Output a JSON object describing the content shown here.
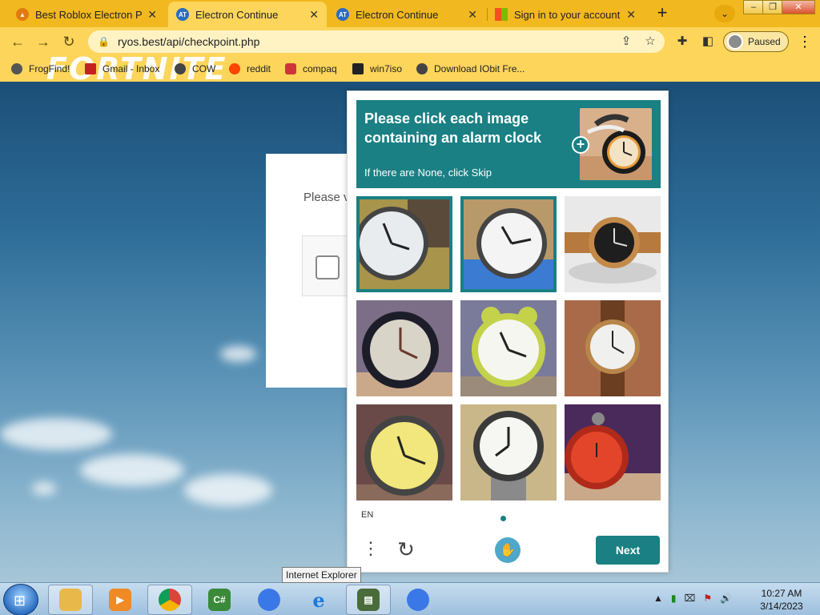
{
  "browser": {
    "tabs": [
      {
        "title": "Best Roblox Electron Prot",
        "active": false
      },
      {
        "title": "Electron Continue",
        "active": true
      },
      {
        "title": "Electron Continue",
        "active": false
      },
      {
        "title": "Sign in to your account",
        "active": false
      }
    ],
    "new_tab": "+",
    "tab_search": "⌄",
    "window": {
      "min": "–",
      "max": "❐",
      "close": "✕"
    },
    "nav": {
      "back": "←",
      "forward": "→",
      "reload": "↻"
    },
    "url": "ryos.best/api/checkpoint.php",
    "profile_status": "Paused",
    "menu": "⋮",
    "bookmarks": [
      {
        "label": "FrogFind!",
        "color": "#555555"
      },
      {
        "label": "Gmail - Inbox",
        "color": "#c5221f"
      },
      {
        "label": "COW",
        "color": "#444444"
      },
      {
        "label": "reddit",
        "color": "#ff4500"
      },
      {
        "label": "compaq",
        "color": "#d13438"
      },
      {
        "label": "win7iso",
        "color": "#222222"
      },
      {
        "label": "Download IObit Fre...",
        "color": "#444444"
      }
    ],
    "logo_text": "FORTNITE"
  },
  "page": {
    "checkbox_prompt": "Please v"
  },
  "captcha": {
    "prompt_title": "Please click each image containing an alarm clock",
    "prompt_sub": "If there are None, click Skip",
    "expand": "+",
    "language": "EN",
    "next_label": "Next",
    "grid": [
      {
        "kind": "wristwatch",
        "selected": true
      },
      {
        "kind": "wristwatch",
        "selected": true
      },
      {
        "kind": "wristwatch",
        "selected": false
      },
      {
        "kind": "alarm-clock",
        "selected": false
      },
      {
        "kind": "alarm-clock",
        "selected": false
      },
      {
        "kind": "wristwatch",
        "selected": false
      },
      {
        "kind": "alarm-clock",
        "selected": false
      },
      {
        "kind": "wristwatch",
        "selected": false
      },
      {
        "kind": "alarm-clock",
        "selected": false
      }
    ]
  },
  "tooltip": "Internet Explorer",
  "taskbar": {
    "apps": [
      {
        "name": "file-explorer",
        "glyph": "📁",
        "color": "#e8b84a",
        "open": true
      },
      {
        "name": "media-player",
        "glyph": "▶",
        "color": "#f08a24",
        "open": false
      },
      {
        "name": "chrome",
        "glyph": "●",
        "color": "#db4437",
        "open": true
      },
      {
        "name": "csharp",
        "glyph": "C#",
        "color": "#3a8a3a",
        "open": false
      },
      {
        "name": "roblox-chrome-1",
        "glyph": "◔",
        "color": "#3b78e7",
        "open": false
      },
      {
        "name": "internet-explorer",
        "glyph": "e",
        "color": "#1f7ad9",
        "open": false
      },
      {
        "name": "task-manager",
        "glyph": "▤",
        "color": "#4a6b3a",
        "open": true
      },
      {
        "name": "roblox-chrome-2",
        "glyph": "◔",
        "color": "#3b78e7",
        "open": false
      }
    ],
    "time": "10:27 AM",
    "date": "3/14/2023"
  }
}
